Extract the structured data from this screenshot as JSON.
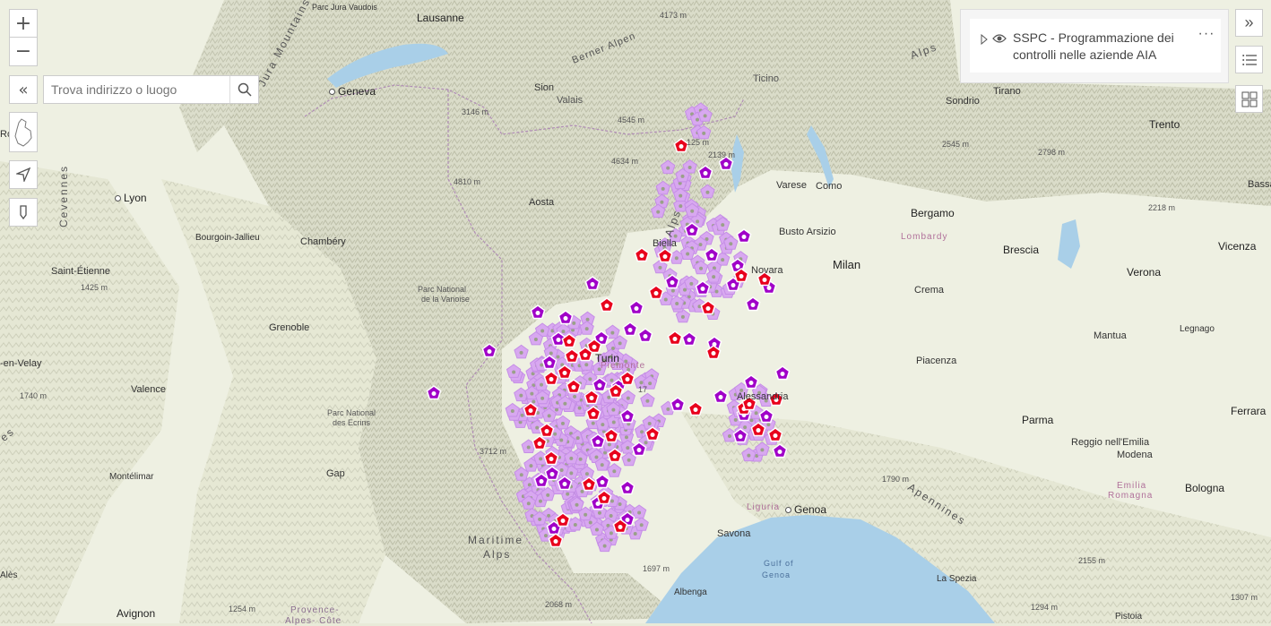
{
  "search": {
    "placeholder": "Trova indirizzo o luogo"
  },
  "layer": {
    "title": "SSPC - Programmazione dei controlli nelle aziende AIA"
  },
  "colors": {
    "marker_red": "#e8001c",
    "marker_purple": "#a000c8",
    "marker_light": "#d8a8f0",
    "sea": "#a9cfe8"
  },
  "icons": [
    "zoom-in-icon",
    "zoom-out-icon",
    "collapse-icon",
    "search-icon",
    "region-outline-icon",
    "locate-icon",
    "pin-icon",
    "expand-panel-icon",
    "list-icon",
    "grid-icon",
    "caret-right-icon",
    "eye-icon",
    "more-icon"
  ],
  "labels": {
    "lausanne": "Lausanne",
    "geneva": "Geneva",
    "sion": "Sion",
    "valais": "Valais",
    "berner_alpen": "Berner Alpen",
    "ticino": "Ticino",
    "tirano": "Tirano",
    "sondrio": "Sondrio",
    "trento": "Trento",
    "bassa": "Bassa",
    "alps_ne": "Alps",
    "parc_jura": "Parc Jura Vaudois",
    "jura_mountains": "Jura Mountains",
    "cevennes": "Cevennes",
    "lyon": "Lyon",
    "bourgoin": "Bourgoin-Jallieu",
    "chambery": "Chambéry",
    "saint_etienne": "Saint-Étienne",
    "grenoble": "Grenoble",
    "en_velay": "-en-Velay",
    "valence": "Valence",
    "montelimar": "Montélimar",
    "gap": "Gap",
    "ales": "Alès",
    "avignon": "Avignon",
    "provence": "Provence-",
    "alpes_cote": "Alpes- Côte",
    "aosta": "Aosta",
    "alps_mid": "Alps",
    "biella": "Biella",
    "varese": "Varese",
    "como": "Como",
    "busto": "Busto Arsizio",
    "bergamo": "Bergamo",
    "lombardy": "Lombardy",
    "brescia": "Brescia",
    "vicenza": "Vicenza",
    "milan": "Milan",
    "verona": "Verona",
    "crema": "Crema",
    "mantua": "Mantua",
    "legnago": "Legnago",
    "piacenza": "Piacenza",
    "parma": "Parma",
    "reggio": "Reggio nell'Emilia",
    "modena": "Modena",
    "emilia": "Emilia",
    "romagna": "Romagna",
    "bologna": "Bologna",
    "ferrara": "Ferrara",
    "apennines": "Apennines",
    "genoa": "Genoa",
    "savona": "Savona",
    "gulf": "Gulf of",
    "gulf2": "Genoa",
    "liguria": "Liguria",
    "albenga": "Albenga",
    "la_spezia": "La Spezia",
    "pistoia": "Pistoia",
    "maritime": "Maritime",
    "alps_mar": "Alps",
    "piemonte": "Piemonte",
    "turin": "Turin",
    "novara": "Novara",
    "alessandria": "Alessandria",
    "parc_vanoise_1": "Parc National",
    "parc_vanoise_2": "de la Vanoise",
    "parc_ecrins_1": "Parc National",
    "parc_ecrins_2": "des Ecrins",
    "ro": "Ro",
    "es": "es",
    "e4173": "4173 m",
    "e3146": "3146 m",
    "e4545": "4545 m",
    "e4634": "4634 m",
    "e4810": "4810 m",
    "e2139": "2139 m",
    "e2545": "2545 m",
    "e2798": "2798 m",
    "e2218": "2218 m",
    "e1425": "1425 m",
    "e1740": "1740 m",
    "e3712": "3712 m",
    "e1790": "1790 m",
    "e1697": "1697 m",
    "e2155": "2155 m",
    "e1294": "1294 m",
    "e1307": "1307 m",
    "e2068": "2068 m",
    "e1254": "1254 m",
    "e1225": "125 m",
    "e17": "17"
  }
}
